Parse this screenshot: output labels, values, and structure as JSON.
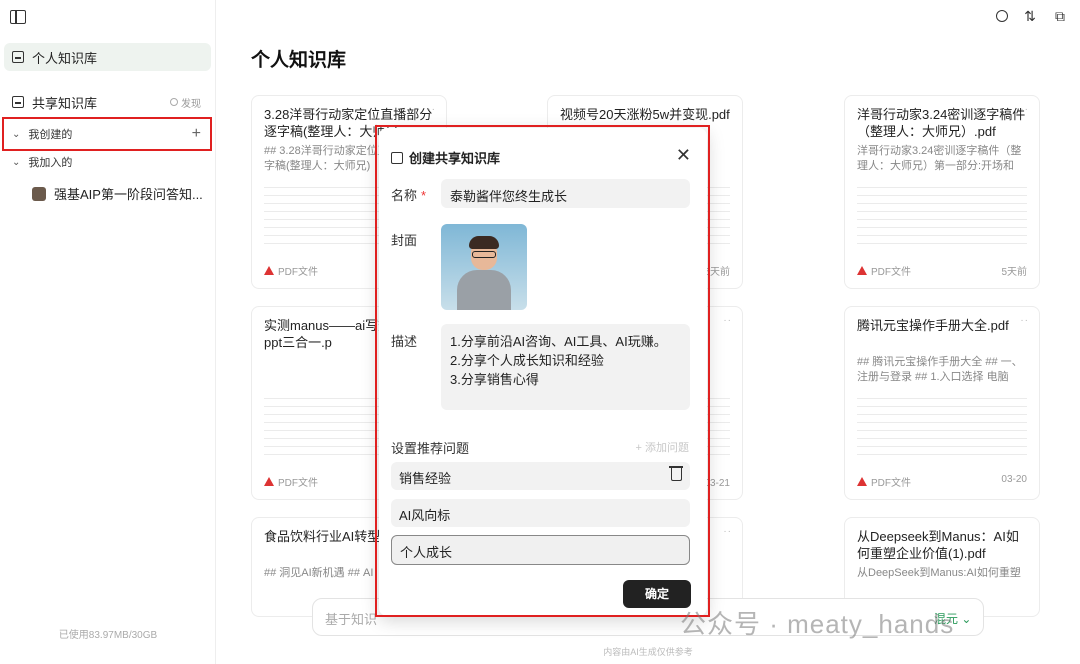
{
  "sidebar": {
    "personal_kb": "个人知识库",
    "shared_kb": "共享知识库",
    "discover": "发现",
    "created_by_me": "我创建的",
    "joined": "我加入的",
    "joined_item": "强基AIP第一阶段问答知...",
    "storage": "已使用83.97MB/30GB"
  },
  "main": {
    "title": "个人知识库",
    "cards": [
      {
        "title": "3.28洋哥行动家定位直播部分逐字稿(整理人：大师兄",
        "summary": "## 3.28洋哥行动家定位直播部分逐字稿(整理人：大师兄)",
        "type": "PDF文件",
        "date": ""
      },
      {
        "title": "视频号20天涨粉5w并变现.pdf",
        "summary": "",
        "type": "",
        "date": "5天前"
      },
      {
        "title": "洋哥行动家3.24密训逐字稿件（整理人：大师兄）.pdf",
        "summary": "洋哥行动家3.24密训逐字稿件（整理人：大师兄）第一部分:开场和企...",
        "type": "PDF文件",
        "date": "5天前"
      },
      {
        "title": "实测manus——ai写数据分析 ppt三合一.p",
        "summary": "",
        "type": "PDF文件",
        "date": ""
      },
      {
        "title": "",
        "summary": "",
        "type": "",
        "date": "03-21"
      },
      {
        "title": "腾讯元宝操作手册大全.pdf",
        "summary": "## 腾讯元宝操作手册大全 ## 一、注册与登录 ## 1.入口选择 电脑端...",
        "type": "PDF文件",
        "date": "03-20"
      },
      {
        "title": "食品饮料行业AI转型(1).pdf",
        "summary": "## 洞见AI新机遇 ## AI",
        "type": "",
        "date": ""
      },
      {
        "title": "从Deepseek到Manus：AI如何重塑企业价值(1).pdf",
        "summary": "从DeepSeek到Manus:AI如何重塑",
        "type": "",
        "date": ""
      }
    ],
    "chat_placeholder": "基于知识",
    "mix_label": "混元",
    "footer": "内容由AI生成仅供参考",
    "watermark": "公众号 · meaty_hands"
  },
  "modal": {
    "title": "创建共享知识库",
    "name_label": "名称",
    "required_mark": "*",
    "name_value": "泰勒酱伴您终生成长",
    "cover_label": "封面",
    "desc_label": "描述",
    "desc_lines": [
      "1.分享前沿AI咨询、AI工具、AI玩赚。",
      "2.分享个人成长知识和经验",
      "3.分享销售心得"
    ],
    "recommend_label": "设置推荐问题",
    "add_question": "+ 添加问题",
    "questions": [
      "销售经验",
      "AI风向标",
      "个人成长"
    ],
    "confirm": "确定"
  }
}
